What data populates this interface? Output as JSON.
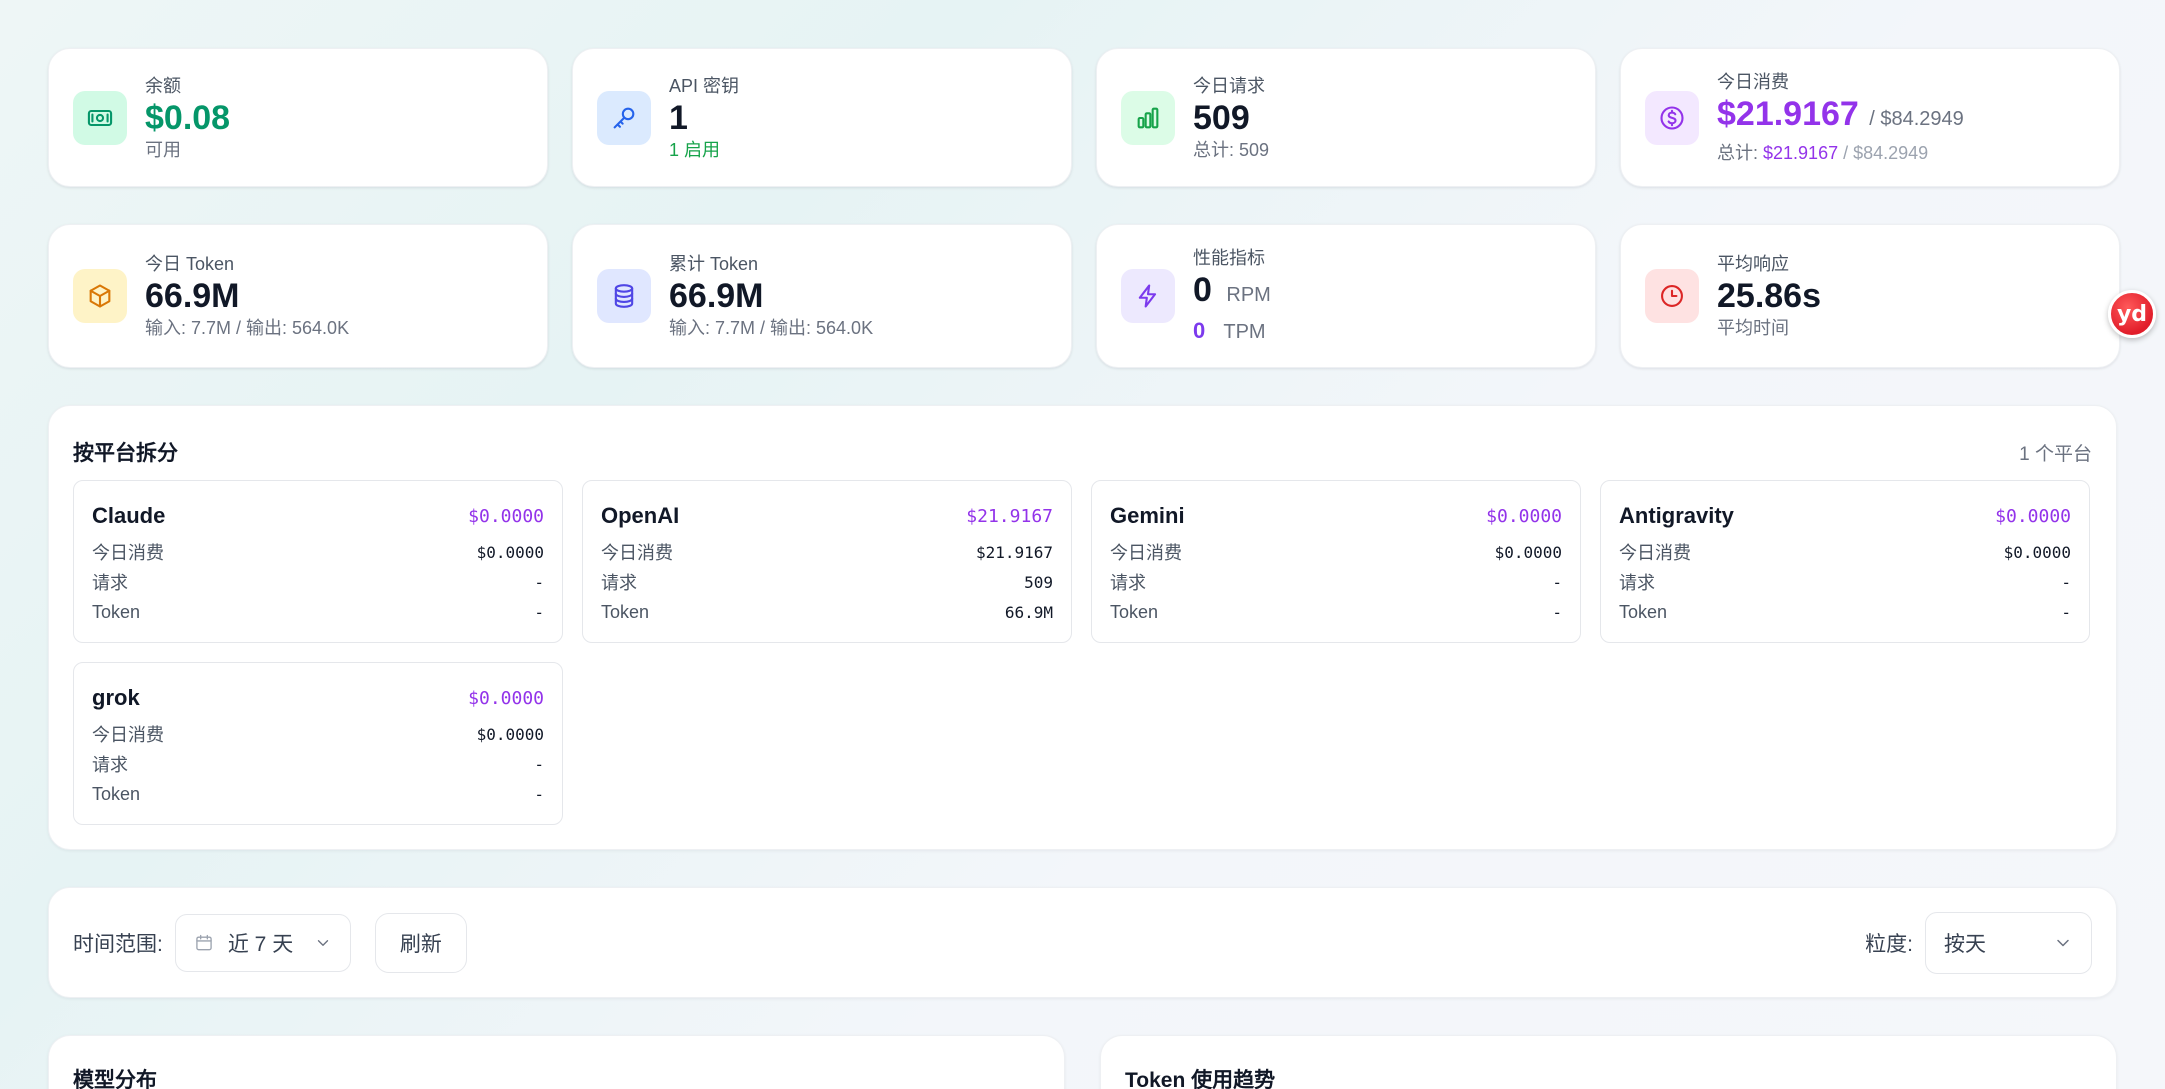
{
  "stats_row1": [
    {
      "label": "余额",
      "value": "$0.08",
      "sub": "可用",
      "icon": "money-icon",
      "icon_bg": "#d1fae5",
      "icon_color": "#059669"
    },
    {
      "label": "API 密钥",
      "value": "1",
      "sub": "1 启用",
      "icon": "key-icon",
      "icon_bg": "#dbeafe",
      "icon_color": "#2563eb"
    },
    {
      "label": "今日请求",
      "value": "509",
      "sub": "总计: 509",
      "icon": "bar-chart-icon",
      "icon_bg": "#dcfce7",
      "icon_color": "#16a34a"
    },
    {
      "label": "今日消费",
      "value": "$21.9167",
      "value_total": "/ $84.2949",
      "sub_prefix": "总计: ",
      "sub_today": "$21.9167",
      "sub_total": " / $84.2949",
      "icon": "dollar-icon",
      "icon_bg": "#f3e8ff",
      "icon_color": "#9333ea"
    }
  ],
  "stats_row2": [
    {
      "label": "今日 Token",
      "value": "66.9M",
      "sub": "输入: 7.7M / 输出: 564.0K",
      "icon": "cube-icon",
      "icon_bg": "#fef3c7",
      "icon_color": "#d97706"
    },
    {
      "label": "累计 Token",
      "value": "66.9M",
      "sub": "输入: 7.7M / 输出: 564.0K",
      "icon": "database-icon",
      "icon_bg": "#e0e7ff",
      "icon_color": "#4f46e5"
    },
    {
      "label": "性能指标",
      "rpm_value": "0",
      "rpm_unit": "RPM",
      "tpm_value": "0",
      "tpm_unit": "TPM",
      "icon": "bolt-icon",
      "icon_bg": "#ede9fe",
      "icon_color": "#7c3aed"
    },
    {
      "label": "平均响应",
      "value": "25.86s",
      "sub": "平均时间",
      "icon": "clock-icon",
      "icon_bg": "#fee2e2",
      "icon_color": "#dc2626"
    }
  ],
  "platforms": {
    "title": "按平台拆分",
    "count": "1 个平台",
    "row_labels": {
      "cost": "今日消费",
      "requests": "请求",
      "tokens": "Token"
    },
    "items": [
      {
        "name": "Claude",
        "cost": "$0.0000",
        "today_cost": "$0.0000",
        "requests": "-",
        "tokens": "-"
      },
      {
        "name": "OpenAI",
        "cost": "$21.9167",
        "today_cost": "$21.9167",
        "requests": "509",
        "tokens": "66.9M"
      },
      {
        "name": "Gemini",
        "cost": "$0.0000",
        "today_cost": "$0.0000",
        "requests": "-",
        "tokens": "-"
      },
      {
        "name": "Antigravity",
        "cost": "$0.0000",
        "today_cost": "$0.0000",
        "requests": "-",
        "tokens": "-"
      },
      {
        "name": "grok",
        "cost": "$0.0000",
        "today_cost": "$0.0000",
        "requests": "-",
        "tokens": "-"
      }
    ]
  },
  "filters": {
    "range_label": "时间范围:",
    "range_value": "近 7 天",
    "refresh_label": "刷新",
    "granularity_label": "粒度:",
    "granularity_value": "按天"
  },
  "bottom": {
    "model_title": "模型分布",
    "token_title": "Token 使用趋势"
  },
  "floating_badge": "yd"
}
